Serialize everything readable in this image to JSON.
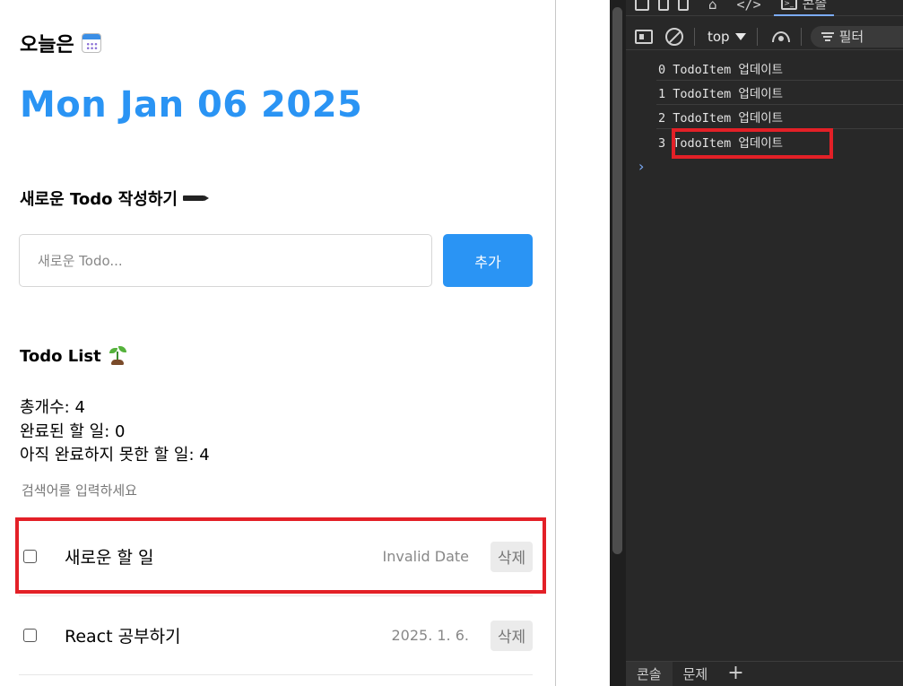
{
  "header": {
    "today_label": "오늘은",
    "date": "Mon Jan 06 2025"
  },
  "editor": {
    "title": "새로운 Todo 작성하기",
    "input_placeholder": "새로운 Todo...",
    "add_label": "추가"
  },
  "list": {
    "title": "Todo List",
    "total": "총개수: 4",
    "done": "완료된 할 일: 0",
    "not_done": "아직 완료하지 못한 할 일: 4",
    "search_placeholder": "검색어를 입력하세요",
    "items": [
      {
        "content": "새로운 할 일",
        "date": "Invalid Date",
        "delete_label": "삭제",
        "checked": false
      },
      {
        "content": "React 공부하기",
        "date": "2025. 1. 6.",
        "delete_label": "삭제",
        "checked": false
      }
    ]
  },
  "devtools": {
    "tab_console_label": "콘솔",
    "context": "top",
    "filter_label": "필터",
    "logs": [
      "0 TodoItem 업데이트",
      "1 TodoItem 업데이트",
      "2 TodoItem 업데이트",
      "3 TodoItem 업데이트"
    ],
    "drawer_tabs": [
      "콘솔",
      "문제"
    ],
    "accent_color": "#7cacf8"
  },
  "colors": {
    "primary": "#2a94f4",
    "highlight": "#e32027"
  }
}
